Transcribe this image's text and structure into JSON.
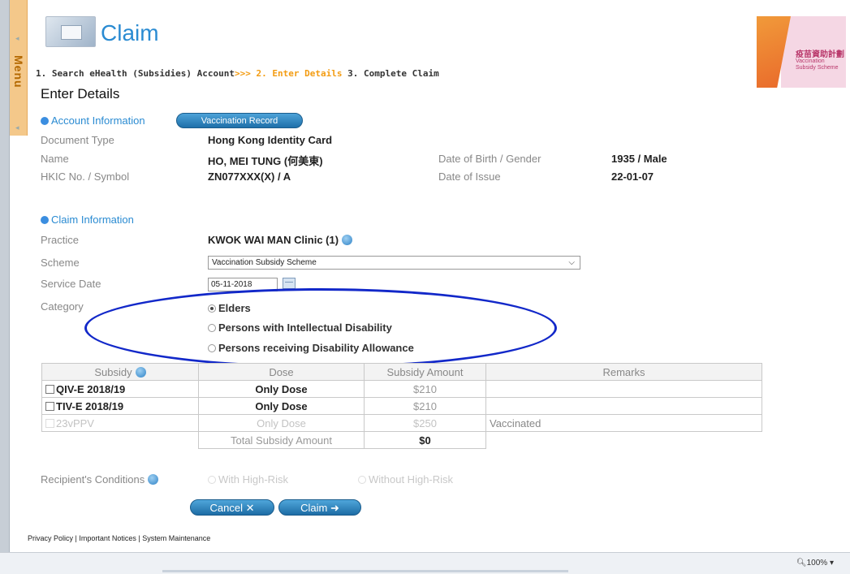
{
  "menu": {
    "label": "Menu"
  },
  "title": "Claim",
  "brand": {
    "zh": "疫苗資助計劃",
    "en": "Vaccination Subsidy Scheme"
  },
  "steps": {
    "step1": "1. Search eHealth (Subsidies) Account",
    "arrows": ">>>",
    "step2": "2. Enter Details",
    "step3": "3. Complete Claim"
  },
  "heading": "Enter Details",
  "account": {
    "section_title": "Account Information",
    "vaccination_record_label": "Vaccination Record",
    "document_type_label": "Document Type",
    "document_type": "Hong Kong Identity Card",
    "name_label": "Name",
    "name": "HO, MEI TUNG (何美東)",
    "dob_label": "Date of Birth / Gender",
    "dob": "1935 / Male",
    "hkic_label": "HKIC No. / Symbol",
    "hkic": "ZN077XXX(X) / A",
    "issue_label": "Date of Issue",
    "issue": "22-01-07"
  },
  "claim": {
    "section_title": "Claim Information",
    "practice_label": "Practice",
    "practice": "KWOK WAI MAN Clinic (1)",
    "scheme_label": "Scheme",
    "scheme_value": "Vaccination Subsidy Scheme",
    "service_date_label": "Service Date",
    "service_date": "05-11-2018",
    "category_label": "Category",
    "categories": [
      {
        "label": "Elders",
        "selected": true
      },
      {
        "label": "Persons with Intellectual Disability",
        "selected": false
      },
      {
        "label": "Persons receiving Disability Allowance",
        "selected": false
      }
    ]
  },
  "table": {
    "headers": [
      "Subsidy",
      "Dose",
      "Subsidy Amount",
      "Remarks"
    ],
    "rows": [
      {
        "subsidy": "QIV-E 2018/19",
        "dose": "Only Dose",
        "amount": "$210",
        "remarks": "",
        "disabled": false
      },
      {
        "subsidy": "TIV-E 2018/19",
        "dose": "Only Dose",
        "amount": "$210",
        "remarks": "",
        "disabled": false
      },
      {
        "subsidy": "23vPPV",
        "dose": "Only Dose",
        "amount": "$250",
        "remarks": "Vaccinated",
        "disabled": true
      }
    ],
    "total_label": "Total Subsidy Amount",
    "total_value": "$0"
  },
  "conditions": {
    "label": "Recipient's Conditions",
    "opt1": "With High-Risk",
    "opt2": "Without High-Risk"
  },
  "buttons": {
    "cancel": "Cancel",
    "claim": "Claim"
  },
  "footer": "Privacy Policy | Important Notices | System Maintenance",
  "status": {
    "zoom": "100%"
  }
}
